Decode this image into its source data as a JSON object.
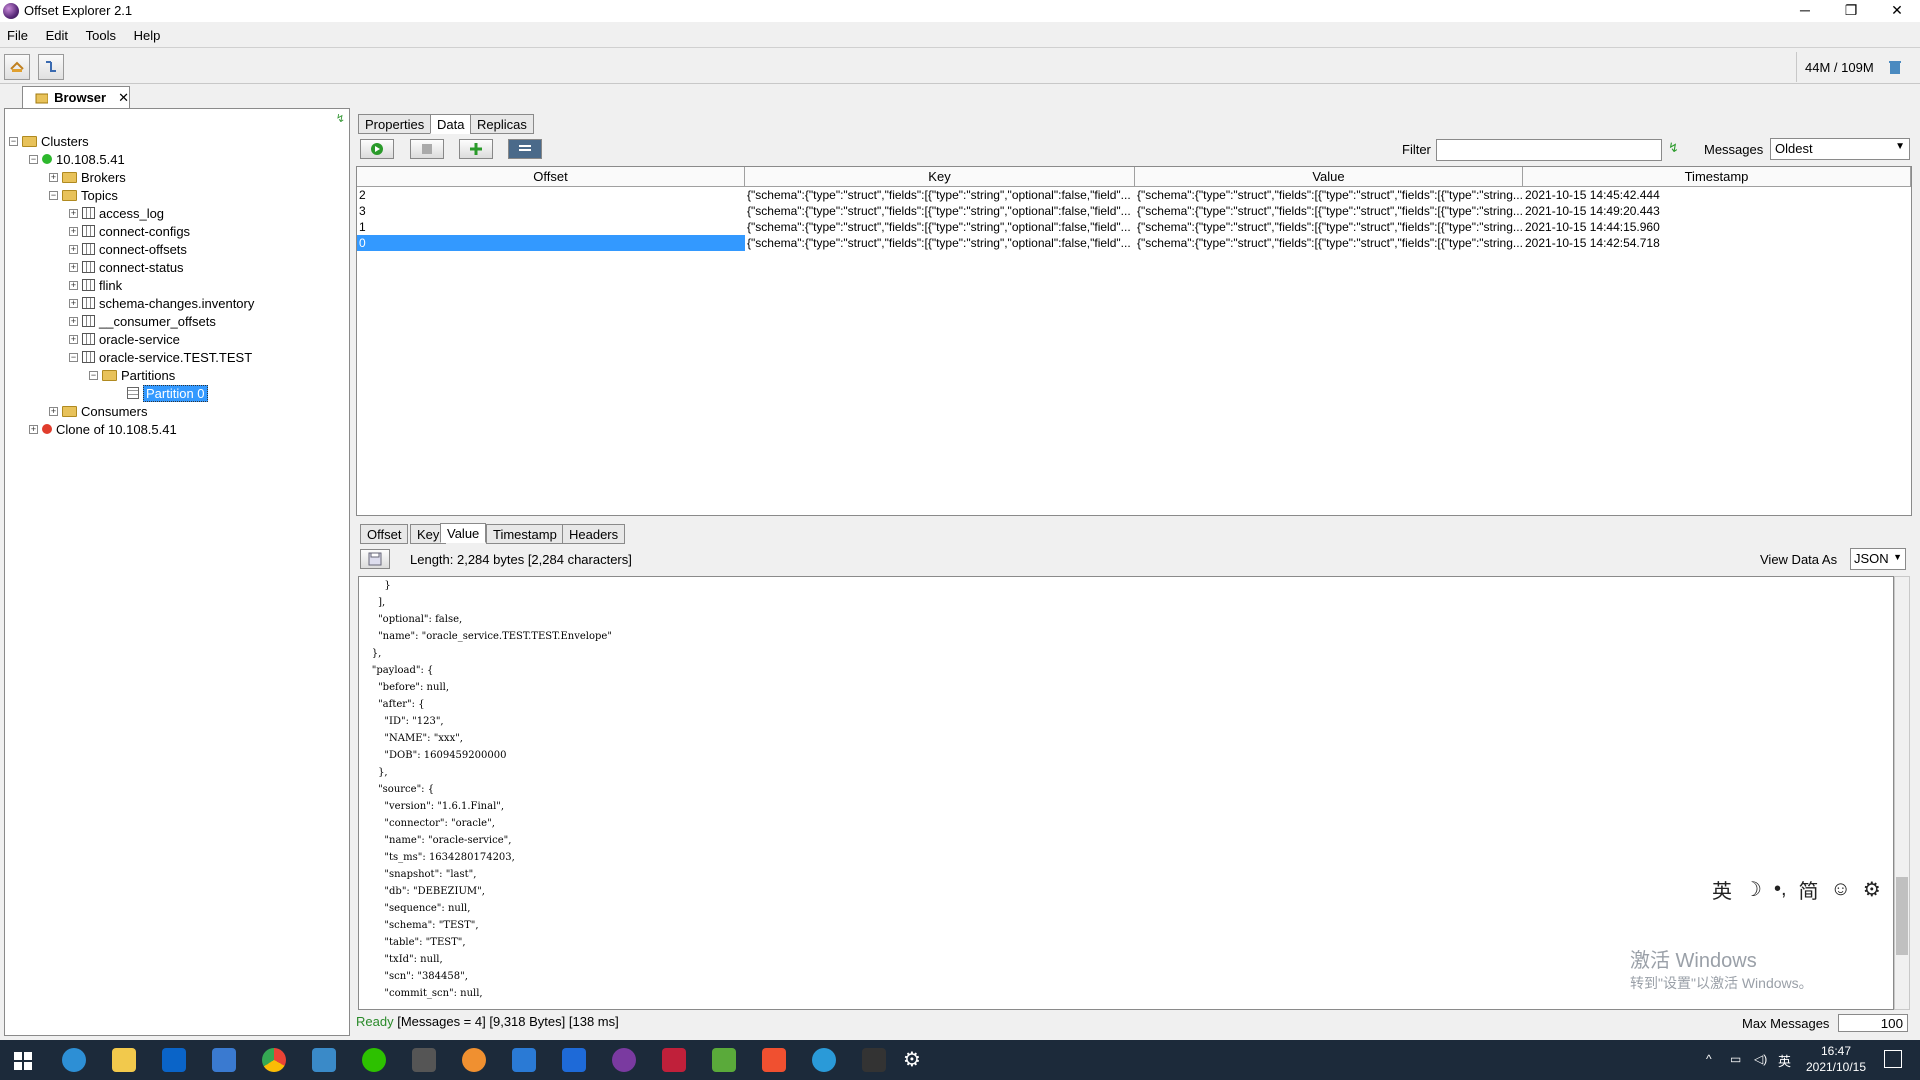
{
  "window": {
    "title": "Offset Explorer  2.1",
    "minimize": "─",
    "maximize": "❐",
    "close": "✕"
  },
  "menu": [
    "File",
    "Edit",
    "Tools",
    "Help"
  ],
  "memory": {
    "text": "44M / 109M",
    "icon": "trash-icon"
  },
  "browser_tab": {
    "label": "Browser",
    "close": "✕"
  },
  "tree": {
    "clusters": "Clusters",
    "cluster1": "10.108.5.41",
    "brokers": "Brokers",
    "topics": "Topics",
    "topic_list": [
      "access_log",
      "connect-configs",
      "connect-offsets",
      "connect-status",
      "flink",
      "schema-changes.inventory",
      "__consumer_offsets",
      "oracle-service",
      "oracle-service.TEST.TEST"
    ],
    "partitions": "Partitions",
    "partition0": "Partition 0",
    "consumers": "Consumers",
    "clone": "Clone of 10.108.5.41"
  },
  "tabs": [
    "Properties",
    "Data",
    "Replicas"
  ],
  "filter_label": "Filter",
  "filter_value": "",
  "messages_label": "Messages",
  "messages_value": "Oldest",
  "table": {
    "columns": [
      "Offset",
      "Key",
      "Value",
      "Timestamp"
    ],
    "rows": [
      {
        "offset": "2",
        "key": "{\"schema\":{\"type\":\"struct\",\"fields\":[{\"type\":\"string\",\"optional\":false,\"field\"...",
        "value": "{\"schema\":{\"type\":\"struct\",\"fields\":[{\"type\":\"struct\",\"fields\":[{\"type\":\"string...",
        "timestamp": "2021-10-15 14:45:42.444"
      },
      {
        "offset": "3",
        "key": "{\"schema\":{\"type\":\"struct\",\"fields\":[{\"type\":\"string\",\"optional\":false,\"field\"...",
        "value": "{\"schema\":{\"type\":\"struct\",\"fields\":[{\"type\":\"struct\",\"fields\":[{\"type\":\"string...",
        "timestamp": "2021-10-15 14:49:20.443"
      },
      {
        "offset": "1",
        "key": "{\"schema\":{\"type\":\"struct\",\"fields\":[{\"type\":\"string\",\"optional\":false,\"field\"...",
        "value": "{\"schema\":{\"type\":\"struct\",\"fields\":[{\"type\":\"struct\",\"fields\":[{\"type\":\"string...",
        "timestamp": "2021-10-15 14:44:15.960"
      },
      {
        "offset": "0",
        "key": "{\"schema\":{\"type\":\"struct\",\"fields\":[{\"type\":\"string\",\"optional\":false,\"field\"...",
        "value": "{\"schema\":{\"type\":\"struct\",\"fields\":[{\"type\":\"struct\",\"fields\":[{\"type\":\"string...",
        "timestamp": "2021-10-15 14:42:54.718"
      }
    ]
  },
  "detail_tabs": [
    "Offset",
    "Key",
    "Value",
    "Timestamp",
    "Headers"
  ],
  "length_text": "Length: 2,284 bytes [2,284 characters]",
  "view_as_label": "View Data As",
  "view_as_value": "JSON",
  "json_lines": [
    "        }",
    "      ],",
    "      \"optional\": false,",
    "      \"name\": \"oracle_service.TEST.TEST.Envelope\"",
    "    },",
    "    \"payload\": {",
    "      \"before\": null,",
    "      \"after\": {",
    "        \"ID\": \"123\",",
    "        \"NAME\": \"xxx\",",
    "        \"DOB\": 1609459200000",
    "      },",
    "      \"source\": {",
    "        \"version\": \"1.6.1.Final\",",
    "        \"connector\": \"oracle\",",
    "        \"name\": \"oracle-service\",",
    "        \"ts_ms\": 1634280174203,",
    "        \"snapshot\": \"last\",",
    "        \"db\": \"DEBEZIUM\",",
    "        \"sequence\": null,",
    "        \"schema\": \"TEST\",",
    "        \"table\": \"TEST\",",
    "        \"txId\": null,",
    "        \"scn\": \"384458\",",
    "        \"commit_scn\": null,"
  ],
  "status": {
    "ready": "Ready",
    "messages": "[Messages = 4]",
    "bytes": "[9,318 Bytes]",
    "time": "[138 ms]"
  },
  "max_messages_label": "Max Messages",
  "max_messages_value": "100",
  "ime": [
    "英",
    "☽",
    "•,",
    "简",
    "☺",
    "⚙"
  ],
  "watermark": {
    "line1": "激活 Windows",
    "line2": "转到\"设置\"以激活 Windows。"
  },
  "clock": {
    "time": "16:47",
    "date": "2021/10/15"
  },
  "tray_lang": "英",
  "colors": {
    "selection": "#3399ff",
    "taskbar": "#1c2a3a"
  }
}
